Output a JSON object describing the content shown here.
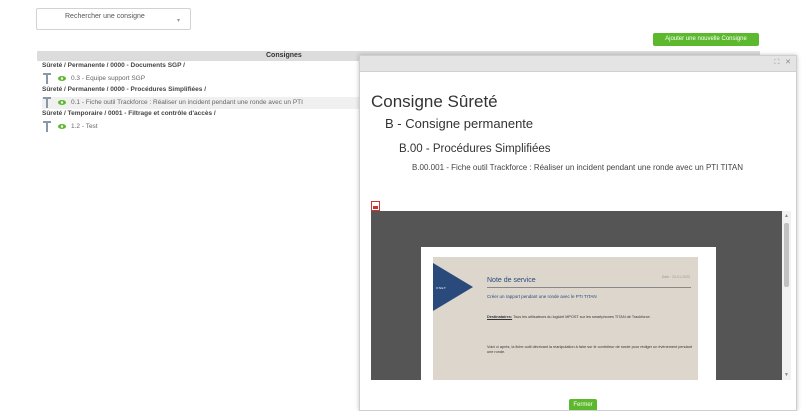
{
  "search": {
    "placeholder": "Rechercher une consigne"
  },
  "toolbar": {
    "add_label": "Ajouter une nouvelle Consigne"
  },
  "table": {
    "header": "Consignes",
    "groups": [
      {
        "label": "Sûreté / Permanente / 0000 - Documents SGP /",
        "items": [
          {
            "label": "0.3 - Equipe support SGP"
          }
        ]
      },
      {
        "label": "Sûreté / Permanente / 0000 - Procédures Simplifiées /",
        "items": [
          {
            "label": "0.1 - Fiche outil Trackforce : Réaliser un incident pendant une ronde avec un PTI"
          }
        ]
      },
      {
        "label": "Sûreté / Temporaire / 0001 - Filtrage et contrôle d'accès /",
        "items": [
          {
            "label": "1.2 - Test"
          }
        ]
      }
    ]
  },
  "modal": {
    "title": "Consigne Sûreté",
    "subtitle": "B - Consigne permanente",
    "section": "B.00 - Procédures Simplifiées",
    "item": "B.00.001 - Fiche outil Trackforce : Réaliser un incident pendant une ronde avec un PTI TITAN",
    "close_label": "Fermer",
    "doc": {
      "brand": "ONET",
      "title": "Note de service",
      "date": "Date : 23-01-2023",
      "line1": "Créer un rapport pendant une ronde avec le PTI TITAN",
      "dest_label": "Destinataires:",
      "dest_text": " Tous les utilisateurs du logiciel MPOST sur les smartphones TITAN de Trackforce.",
      "line3": "Voici ci après, la fiche outil décrivant la manipulation à faire sur le contrôleur de ronde pour rédiger un événement pendant une ronde."
    }
  },
  "colors": {
    "accent": "#5cb82d",
    "brand_blue": "#2a4a7c",
    "doc_bg": "#dcd6cd"
  }
}
